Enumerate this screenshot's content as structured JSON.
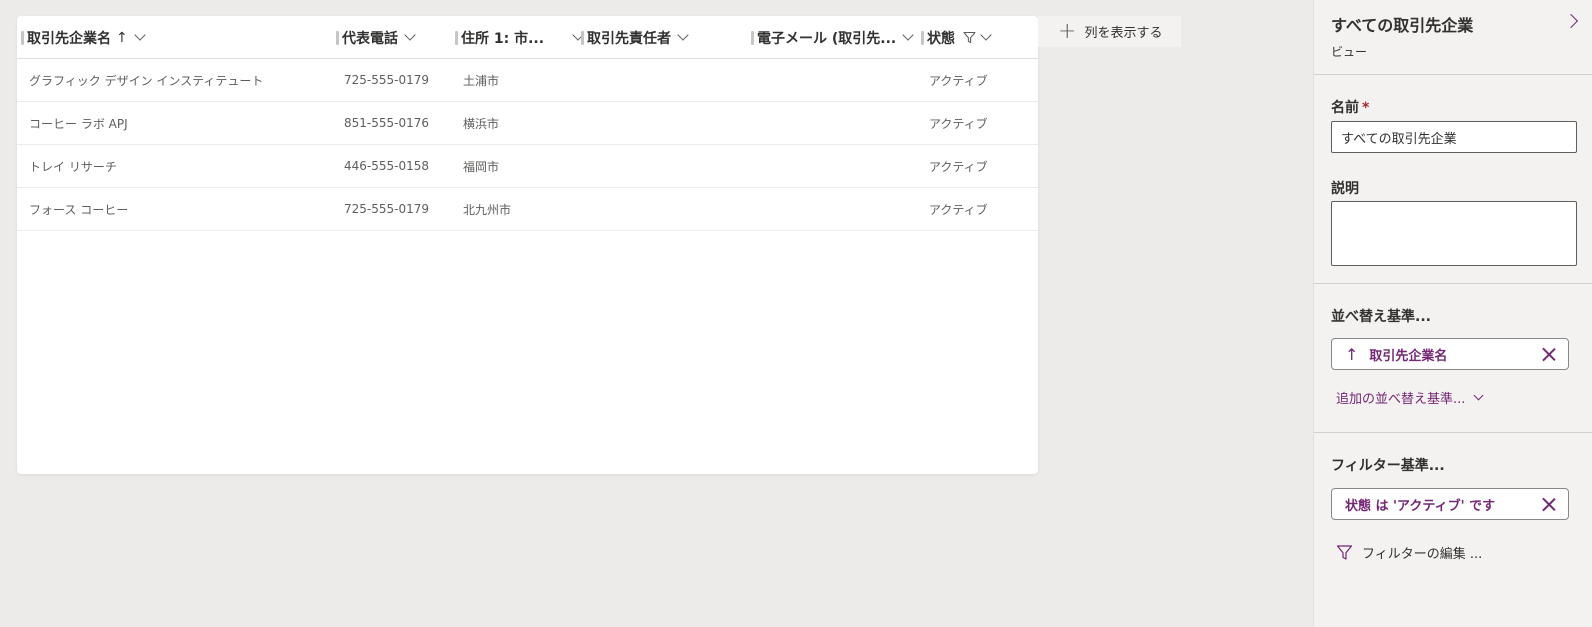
{
  "grid": {
    "columns": [
      {
        "label": "取引先企業名",
        "sort": "↑"
      },
      {
        "label": "代表電話"
      },
      {
        "label": "住所 1: 市..."
      },
      {
        "label": "取引先責任者"
      },
      {
        "label": "電子メール (取引先..."
      },
      {
        "label": "状態"
      }
    ],
    "rows": [
      [
        "グラフィック デザイン インスティテュート",
        "725-555-0179",
        "土浦市",
        "",
        "",
        "アクティブ"
      ],
      [
        "コーヒー ラボ APJ",
        "851-555-0176",
        "横浜市",
        "",
        "",
        "アクティブ"
      ],
      [
        "トレイ リサーチ",
        "446-555-0158",
        "福岡市",
        "",
        "",
        "アクティブ"
      ],
      [
        "フォース コーヒー",
        "725-555-0179",
        "北九州市",
        "",
        "",
        "アクティブ"
      ]
    ]
  },
  "add_column": {
    "label": "列を表示する"
  },
  "panel": {
    "title": "すべての取引先企業",
    "subtitle": "ビュー",
    "name_label": "名前",
    "required_mark": "*",
    "name_value": "すべての取引先企業",
    "description_label": "説明",
    "description_value": "",
    "sort_label": "並べ替え基準...",
    "sort_chip": {
      "arrow": "↑",
      "label": "取引先企業名"
    },
    "add_sort_label": "追加の並べ替え基準...",
    "filter_label": "フィルター基準...",
    "filter_chip": {
      "label": "状態 は 'アクティブ' です"
    },
    "edit_filter_label": "フィルターの編集 ..."
  },
  "colors": {
    "accent": "#742774",
    "background": "#ecebea",
    "panel": "#f3f2f1"
  }
}
